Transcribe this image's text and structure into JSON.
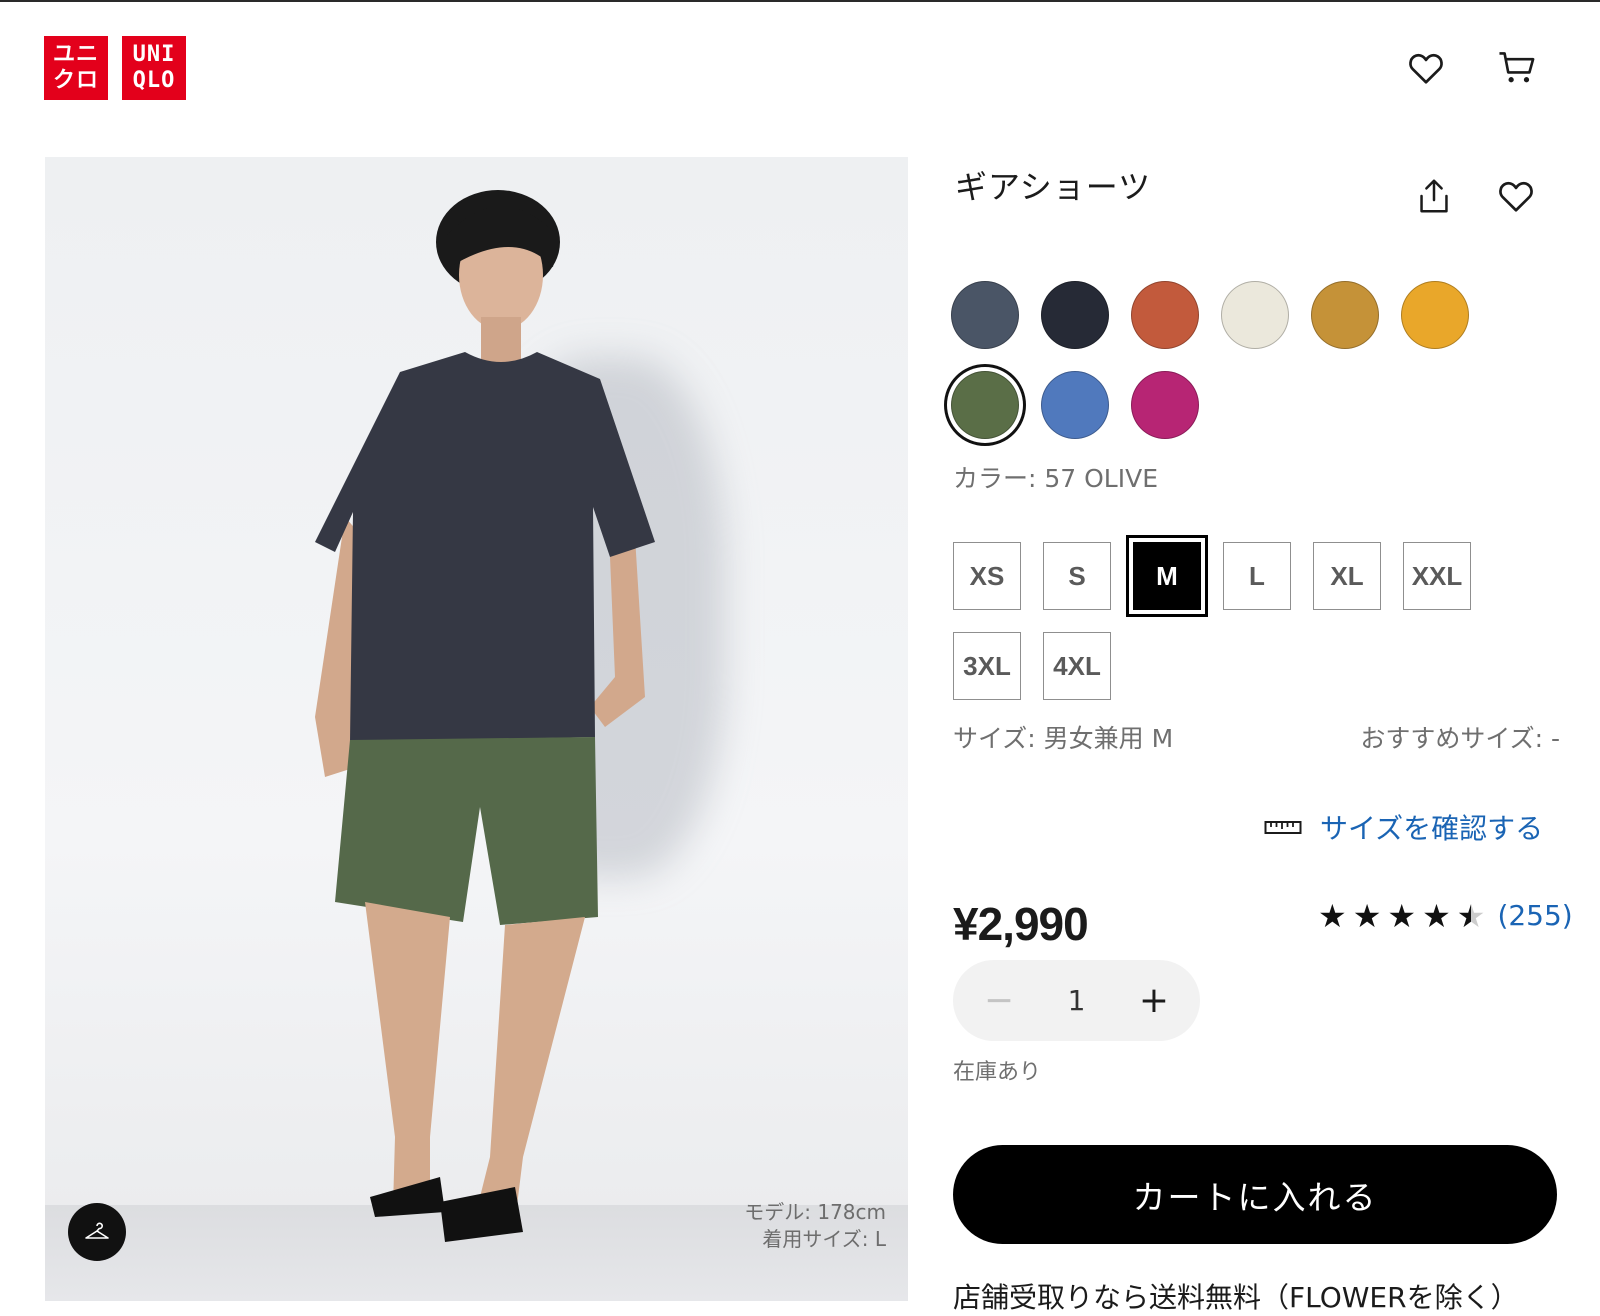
{
  "header": {
    "logo_top": "ユニ",
    "logo_bottom": "クロ",
    "logo_latin_top": "UNI",
    "logo_latin_bottom": "QLO",
    "wishlist_icon": "heart-icon",
    "cart_icon": "cart-icon"
  },
  "product": {
    "title": "ギアショーツ",
    "model_height": "モデル: 178cm",
    "model_size": "着用サイズ: L",
    "colors": [
      {
        "name": "navy",
        "hex": "#4a5566"
      },
      {
        "name": "dark-navy",
        "hex": "#262a36"
      },
      {
        "name": "orange",
        "hex": "#c25a3c"
      },
      {
        "name": "off-white",
        "hex": "#ebe8dc"
      },
      {
        "name": "mustard",
        "hex": "#c59238"
      },
      {
        "name": "yellow",
        "hex": "#e9a72a"
      },
      {
        "name": "olive",
        "hex": "#5a6e47"
      },
      {
        "name": "blue",
        "hex": "#5079bd"
      },
      {
        "name": "magenta",
        "hex": "#b72574"
      }
    ],
    "selected_color_index": 6,
    "color_label": "カラー: 57 OLIVE",
    "sizes": [
      "XS",
      "S",
      "M",
      "L",
      "XL",
      "XXL",
      "3XL",
      "4XL"
    ],
    "selected_size_index": 2,
    "size_label": "サイズ: 男女兼用 M",
    "recommended_size": "おすすめサイズ: -",
    "size_check_link": "サイズを確認する",
    "price": "¥2,990",
    "rating_value": 4.5,
    "rating_count": "(255)",
    "quantity": "1",
    "stock_status": "在庫あり",
    "add_to_cart": "カートに入れる",
    "shipping_note": "店舗受取りなら送料無料（FLOWERを除く）"
  },
  "colors": {
    "brand_red": "#e3001b",
    "link_blue": "#1a64b4"
  }
}
